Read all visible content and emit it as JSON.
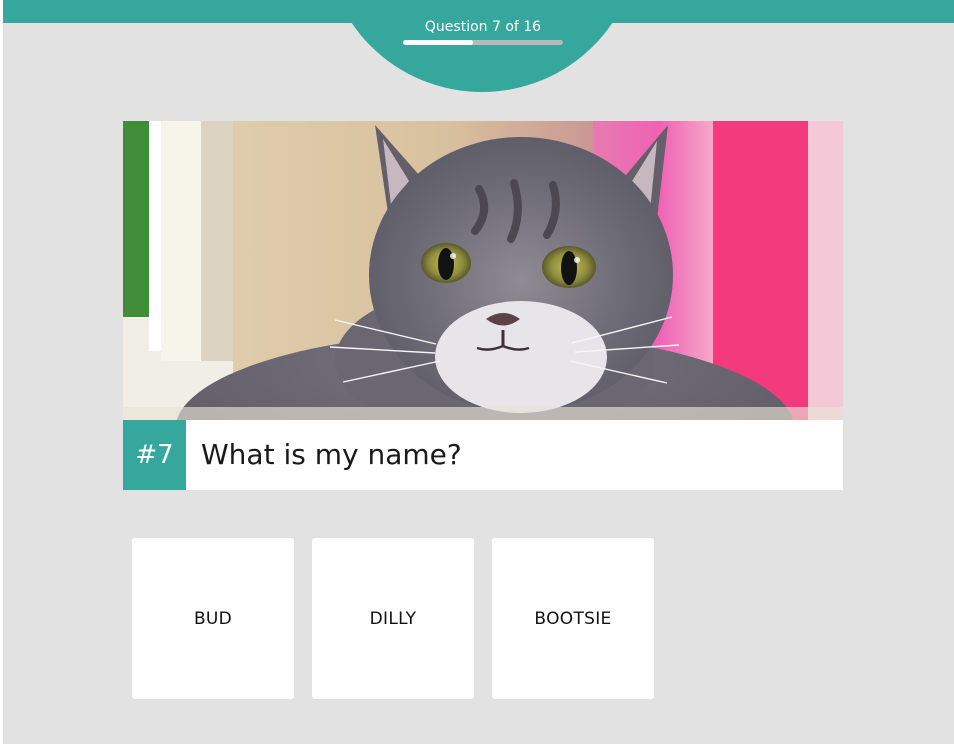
{
  "header": {
    "question_counter": "Question 7 of 16",
    "progress_fraction": 0.4375,
    "accent_color": "#35a79c"
  },
  "question": {
    "number_label": "#7",
    "text": "What is my name?",
    "image_subject": "gray-tabby-cat-photo"
  },
  "answers": [
    {
      "label": "BUD"
    },
    {
      "label": "DILLY"
    },
    {
      "label": "BOOTSIE"
    }
  ],
  "colors": {
    "background": "#e2e2e2",
    "card": "#ffffff",
    "accent": "#35a79c",
    "text": "#1a1a1a"
  }
}
